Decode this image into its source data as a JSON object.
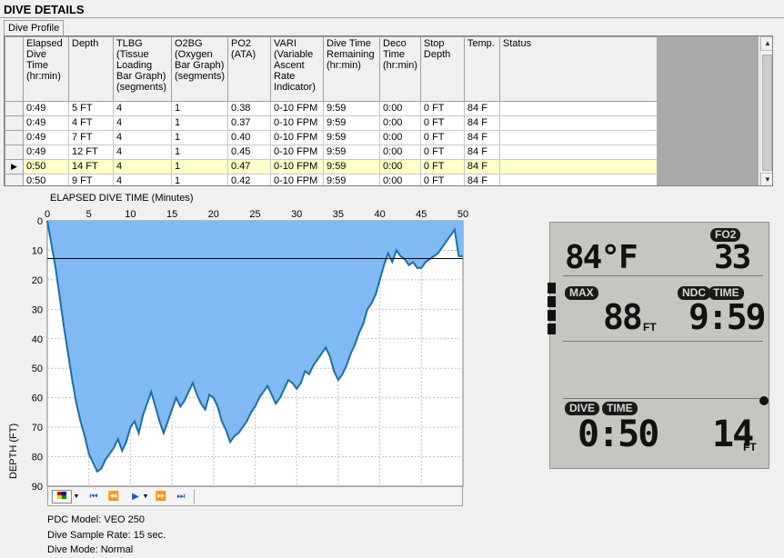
{
  "panel": {
    "title": "DIVE DETAILS",
    "tab_label": "Dive Profile"
  },
  "grid": {
    "columns": [
      "Elapsed Dive Time (hr:min)",
      "Depth",
      "TLBG (Tissue Loading Bar Graph) (segments)",
      "O2BG (Oxygen Bar Graph) (segments)",
      "PO2 (ATA)",
      "VARI (Variable Ascent Rate Indicator)",
      "Dive Time Remaining (hr:min)",
      "Deco Time (hr:min)",
      "Stop Depth",
      "Temp.",
      "Status"
    ],
    "rows": [
      [
        "0:49",
        "5 FT",
        "4",
        "1",
        "0.38",
        "0-10 FPM",
        "9:59",
        "0:00",
        "0 FT",
        "84 F",
        ""
      ],
      [
        "0:49",
        "4 FT",
        "4",
        "1",
        "0.37",
        "0-10 FPM",
        "9:59",
        "0:00",
        "0 FT",
        "84 F",
        ""
      ],
      [
        "0:49",
        "7 FT",
        "4",
        "1",
        "0.40",
        "0-10 FPM",
        "9:59",
        "0:00",
        "0 FT",
        "84 F",
        ""
      ],
      [
        "0:49",
        "12 FT",
        "4",
        "1",
        "0.45",
        "0-10 FPM",
        "9:59",
        "0:00",
        "0 FT",
        "84 F",
        ""
      ],
      [
        "0:50",
        "14 FT",
        "4",
        "1",
        "0.47",
        "0-10 FPM",
        "9:59",
        "0:00",
        "0 FT",
        "84 F",
        ""
      ],
      [
        "0:50",
        "9 FT",
        "4",
        "1",
        "0.42",
        "0-10 FPM",
        "9:59",
        "0:00",
        "0 FT",
        "84 F",
        ""
      ]
    ],
    "selected_row": 4,
    "row_pointer": "▶"
  },
  "chart_data": {
    "type": "area",
    "title": "ELAPSED DIVE TIME (Minutes)",
    "xlabel": "ELAPSED DIVE TIME (Minutes)",
    "ylabel": "DEPTH (FT)",
    "xlim": [
      0,
      50
    ],
    "ylim": [
      0,
      90
    ],
    "y_inverted": true,
    "x_ticks": [
      0,
      5,
      10,
      15,
      20,
      25,
      30,
      35,
      40,
      45,
      50
    ],
    "y_ticks": [
      0,
      10,
      20,
      30,
      40,
      50,
      60,
      70,
      80,
      90
    ],
    "cursor_depth": 12.8,
    "fill_color": "#7fbaf5",
    "line_color": "#1a6fa8",
    "x": [
      0,
      0.5,
      1,
      1.5,
      2,
      2.5,
      3,
      3.5,
      4,
      4.5,
      5,
      5.5,
      6,
      6.5,
      7,
      7.5,
      8,
      8.5,
      9,
      9.5,
      10,
      10.5,
      11,
      11.5,
      12,
      12.5,
      13,
      13.5,
      14,
      14.5,
      15,
      15.5,
      16,
      16.5,
      17,
      17.5,
      18,
      18.5,
      19,
      19.5,
      20,
      20.5,
      21,
      21.5,
      22,
      22.5,
      23,
      23.5,
      24,
      24.5,
      25,
      25.5,
      26,
      26.5,
      27,
      27.5,
      28,
      28.5,
      29,
      29.5,
      30,
      30.5,
      31,
      31.5,
      32,
      32.5,
      33,
      33.5,
      34,
      34.5,
      35,
      35.5,
      36,
      36.5,
      37,
      37.5,
      38,
      38.5,
      39,
      39.5,
      40,
      40.5,
      41,
      41.5,
      42,
      42.5,
      43,
      43.5,
      44,
      44.5,
      45,
      45.5,
      46,
      46.5,
      47,
      47.5,
      48,
      48.5,
      49,
      49.5,
      50
    ],
    "depth": [
      0,
      8,
      16,
      26,
      36,
      45,
      54,
      62,
      68,
      73,
      79,
      82,
      85,
      84,
      81,
      79,
      77,
      74,
      78,
      75,
      70,
      68,
      72,
      66,
      62,
      58,
      63,
      68,
      72,
      68,
      64,
      60,
      63,
      61,
      58,
      55,
      59,
      62,
      64,
      59,
      60,
      63,
      68,
      71,
      75,
      73,
      72,
      70,
      68,
      65,
      63,
      60,
      58,
      56,
      59,
      62,
      60,
      57,
      54,
      55,
      57,
      55,
      51,
      52,
      49,
      47,
      45,
      43,
      46,
      51,
      54,
      52,
      49,
      45,
      42,
      38,
      35,
      30,
      28,
      25,
      20,
      15,
      11,
      14,
      10,
      12,
      13,
      15,
      14,
      16,
      16,
      14,
      13,
      12,
      11,
      9,
      7,
      5,
      3,
      12,
      12
    ]
  },
  "chart_toolbar": {
    "buttons": [
      "first",
      "prev",
      "play",
      "next",
      "last"
    ]
  },
  "info": {
    "model": "PDC Model: VEO 250",
    "rate": "Dive Sample Rate: 15 sec.",
    "mode": "Dive Mode: Normal"
  },
  "lcd": {
    "temp": "84°F",
    "fo2_label": "FO2",
    "fo2_value": "33",
    "max_label": "MAX",
    "max_value": "88",
    "max_unit": "FT",
    "ndc_label": "NDC",
    "time_label": "TIME",
    "ndc_value": "9:59",
    "dive_label": "DIVE",
    "dive_time_label": "TIME",
    "dive_time_value": "0:50",
    "depth_value": "14",
    "depth_unit": "FT"
  }
}
